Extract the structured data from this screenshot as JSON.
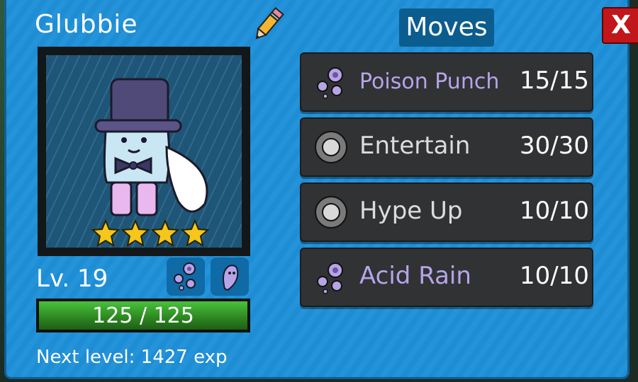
{
  "monster": {
    "name": "Glubbie",
    "level_text": "Lv. 19",
    "hp_text": "125 / 125",
    "hp_fraction": 1.0,
    "stars": 4,
    "next_level_text": "Next level: 1427 exp",
    "types": [
      "poison-type-icon",
      "ghost-type-icon"
    ]
  },
  "moves_panel": {
    "title": "Moves",
    "close_label": "X",
    "moves": [
      {
        "name": "Poison Punch",
        "pp": "15/15",
        "type": "poison"
      },
      {
        "name": "Entertain",
        "pp": "30/30",
        "type": "normal"
      },
      {
        "name": "Hype Up",
        "pp": "10/10",
        "type": "normal"
      },
      {
        "name": "Acid Rain",
        "pp": "10/10",
        "type": "poison"
      }
    ]
  },
  "colors": {
    "panel": "#1e90d8",
    "poison_text": "#b7a4e8",
    "close_button": "#c2161a",
    "hp_green": "#3fae33"
  }
}
